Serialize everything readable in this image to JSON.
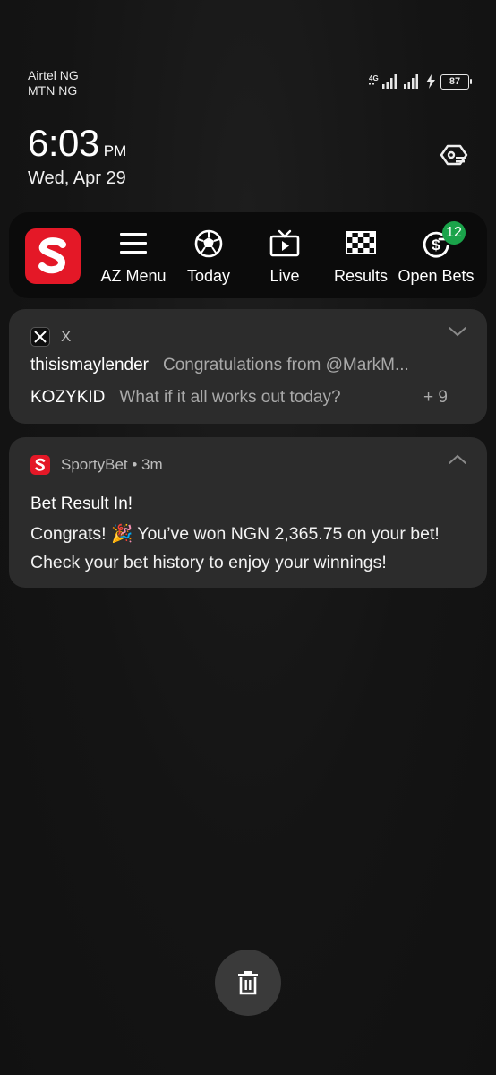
{
  "status_bar": {
    "carrier_1": "Airtel NG",
    "carrier_2": "MTN NG",
    "network_type": "4G",
    "battery": "87",
    "icons": [
      "signal-icon",
      "signal-icon",
      "charging-icon",
      "battery-icon"
    ]
  },
  "clock": {
    "time": "6:03",
    "ampm": "PM",
    "date": "Wed, Apr 29"
  },
  "widget": {
    "app": "SportyBet",
    "logo_letter": "S",
    "brand_color": "#e41827",
    "items": [
      {
        "label": "AZ Menu",
        "icon": "menu-icon"
      },
      {
        "label": "Today",
        "icon": "soccer-ball-icon"
      },
      {
        "label": "Live",
        "icon": "tv-icon"
      },
      {
        "label": "Results",
        "icon": "checkered-flag-icon"
      },
      {
        "label": "Open Bets",
        "icon": "refresh-dollar-icon",
        "badge": "12"
      }
    ],
    "badge_color": "#1aa34a"
  },
  "notifications": {
    "x": {
      "app_name": "X",
      "messages": [
        {
          "sender": "thisismaylender",
          "text": "Congratulations from @MarkM..."
        },
        {
          "sender": "KOZYKID",
          "text": "What if it all works out today?"
        }
      ],
      "more": "+ 9"
    },
    "sportybet": {
      "app_name": "SportyBet",
      "time": "3m",
      "meta": "SportyBet • 3m",
      "title": "Bet Result In!",
      "body": "Congrats! 🎉 You’ve won NGN 2,365.75 on your bet! Check your bet history to enjoy your winnings!"
    }
  },
  "clear_all": {
    "icon": "trash-icon"
  }
}
